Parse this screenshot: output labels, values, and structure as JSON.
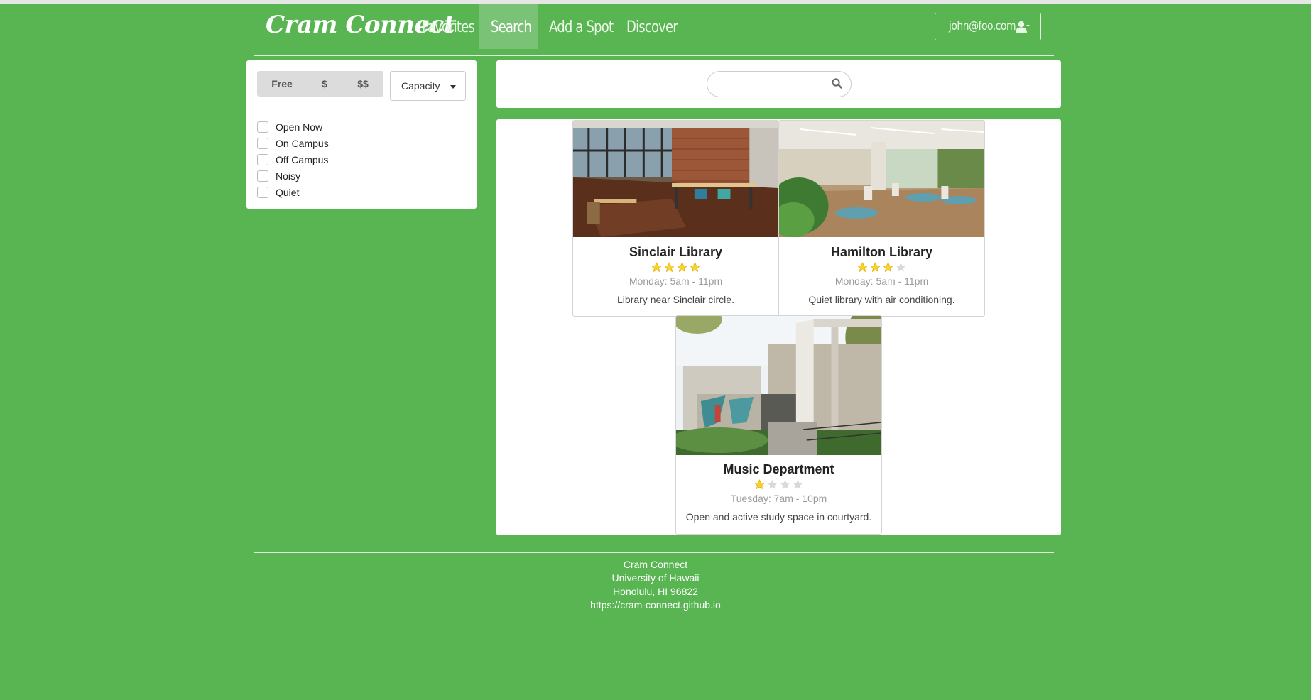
{
  "nav": {
    "brand": "Cram Connect",
    "items": [
      {
        "label": "Favorites",
        "active": false
      },
      {
        "label": "Search",
        "active": true
      },
      {
        "label": "Add a Spot",
        "active": false
      },
      {
        "label": "Discover",
        "active": false
      }
    ],
    "user": "john@foo.com",
    "user_icon": "user-icon"
  },
  "filters": {
    "price_options": [
      "Free",
      "$",
      "$$"
    ],
    "capacity_label": "Capacity",
    "checkboxes": [
      "Open Now",
      "On Campus",
      "Off Campus",
      "Noisy",
      "Quiet"
    ]
  },
  "search": {
    "placeholder": "",
    "value": "",
    "icon": "search-icon"
  },
  "spots": [
    {
      "name": "Sinclair Library",
      "rating": 4,
      "max_rating": 4,
      "hours": "Monday: 5am - 11pm",
      "description": "Library near Sinclair circle."
    },
    {
      "name": "Hamilton Library",
      "rating": 3,
      "max_rating": 4,
      "hours": "Monday: 5am - 11pm",
      "description": "Quiet library with air conditioning."
    },
    {
      "name": "Music Department",
      "rating": 1,
      "max_rating": 4,
      "hours": "Tuesday: 7am - 10pm",
      "description": "Open and active study space in courtyard."
    }
  ],
  "footer": {
    "name": "Cram Connect",
    "university": "University of Hawaii",
    "address": "Honolulu, HI 96822",
    "url": "https://cram-connect.github.io"
  },
  "colors": {
    "background": "#58b552",
    "star_filled": "#fbd22c",
    "star_empty": "#d9d9d9"
  }
}
